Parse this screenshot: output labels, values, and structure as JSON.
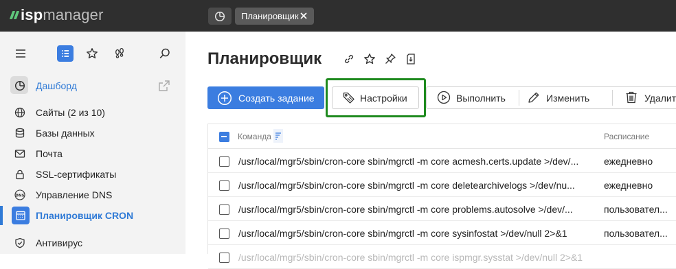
{
  "app": {
    "logo_isp": "isp",
    "logo_manager": "manager",
    "home_tab_icon": "dashboard-icon",
    "active_tab": "Планировщик"
  },
  "sidebar": {
    "tools": [
      "menu-icon",
      "list-icon",
      "star-icon",
      "footprints-icon",
      "search-icon"
    ],
    "dashboard": "Дашборд",
    "items": [
      {
        "label": "Сайты (2 из 10)",
        "icon": "globe-icon"
      },
      {
        "label": "Базы данных",
        "icon": "database-icon"
      },
      {
        "label": "Почта",
        "icon": "mail-icon"
      },
      {
        "label": "SSL-сертификаты",
        "icon": "lock-icon"
      },
      {
        "label": "Управление DNS",
        "icon": "dns-icon"
      },
      {
        "label": "Планировщик CRON",
        "icon": "calendar-icon",
        "active": true
      },
      {
        "label": "Антивирус",
        "icon": "shield-icon"
      }
    ]
  },
  "main": {
    "title": "Планировщик",
    "title_icons": [
      "link-icon",
      "star-icon",
      "pin-icon",
      "export-icon"
    ],
    "toolbar": {
      "create": "Создать задание",
      "settings": "Настройки",
      "run": "Выполнить",
      "edit": "Изменить",
      "delete": "Удалить"
    },
    "table": {
      "columns": [
        "Команда",
        "Расписание"
      ],
      "rows": [
        {
          "command": "/usr/local/mgr5/sbin/cron-core sbin/mgrctl -m core acmesh.certs.update >/dev/...",
          "schedule": "ежедневно"
        },
        {
          "command": "/usr/local/mgr5/sbin/cron-core sbin/mgrctl -m core deletearchivelogs >/dev/nu...",
          "schedule": "ежедневно"
        },
        {
          "command": "/usr/local/mgr5/sbin/cron-core sbin/mgrctl -m core problems.autosolve >/dev/...",
          "schedule": "пользовател..."
        },
        {
          "command": "/usr/local/mgr5/sbin/cron-core sbin/mgrctl -m core sysinfostat >/dev/null 2>&1",
          "schedule": "пользовател..."
        },
        {
          "command": "/usr/local/mgr5/sbin/cron-core sbin/mgrctl -m core ispmgr.sysstat >/dev/null 2>&1",
          "schedule": ""
        }
      ]
    }
  },
  "colors": {
    "accent": "#3b7de0",
    "topbar": "#2f2f2f",
    "highlight": "#1e8a1e",
    "logo_green": "#5fc67b"
  }
}
